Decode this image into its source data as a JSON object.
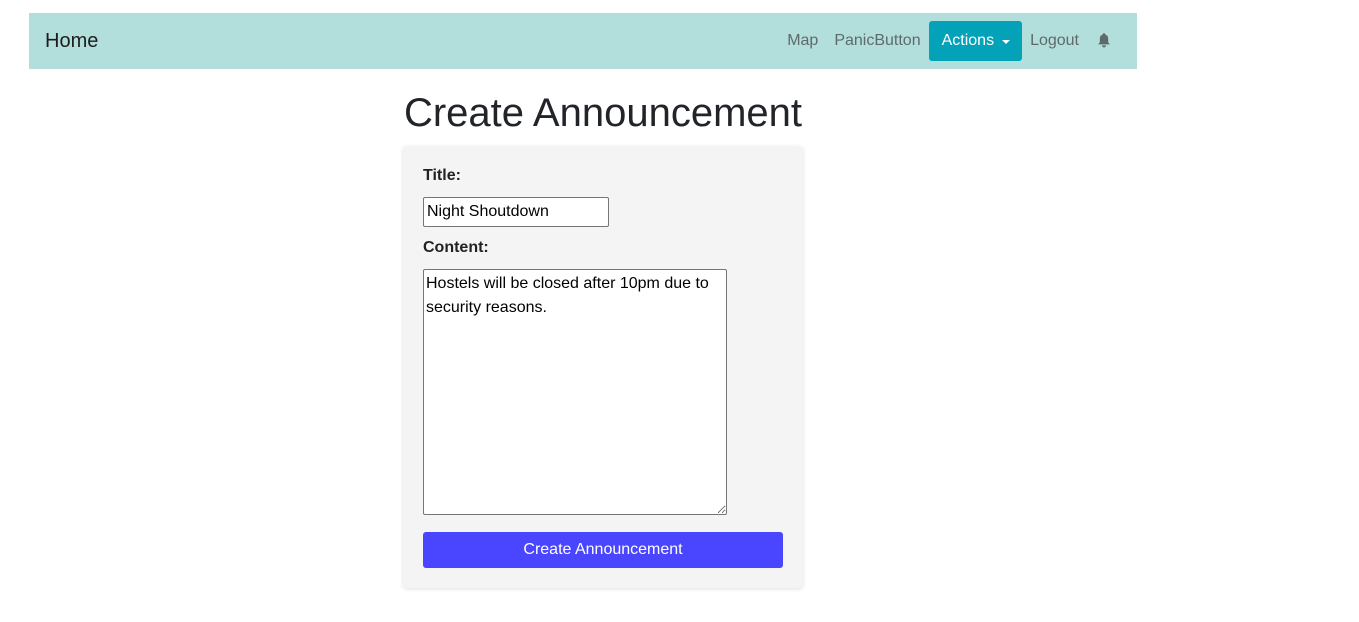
{
  "navbar": {
    "brand": "Home",
    "links": {
      "map": "Map",
      "panic": "PanicButton",
      "actions": "Actions",
      "logout": "Logout"
    },
    "bell_icon": "bell-icon",
    "color": "#b2dfdb",
    "actions_color": "#03a2b8"
  },
  "page": {
    "title": "Create Announcement"
  },
  "form": {
    "title_label": "Title:",
    "title_value": "Night Shoutdown",
    "content_label": "Content:",
    "content_value": "Hostels will be closed after 10pm due to security reasons.",
    "submit_label": "Create Announcement",
    "submit_color": "#4a45ff"
  }
}
